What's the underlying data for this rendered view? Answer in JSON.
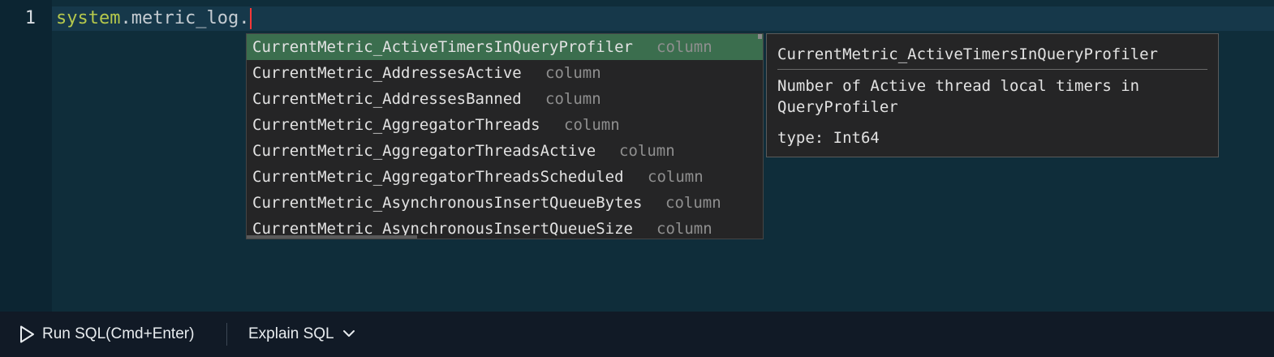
{
  "editor": {
    "line_number": "1",
    "code": {
      "schema": "system",
      "dot1": ".",
      "table": "metric_log",
      "dot2": "."
    }
  },
  "suggestions": {
    "selected_index": 0,
    "items": [
      {
        "label": "CurrentMetric_ActiveTimersInQueryProfiler",
        "kind": "column"
      },
      {
        "label": "CurrentMetric_AddressesActive",
        "kind": "column"
      },
      {
        "label": "CurrentMetric_AddressesBanned",
        "kind": "column"
      },
      {
        "label": "CurrentMetric_AggregatorThreads",
        "kind": "column"
      },
      {
        "label": "CurrentMetric_AggregatorThreadsActive",
        "kind": "column"
      },
      {
        "label": "CurrentMetric_AggregatorThreadsScheduled",
        "kind": "column"
      },
      {
        "label": "CurrentMetric_AsynchronousInsertQueueBytes",
        "kind": "column"
      },
      {
        "label": "CurrentMetric_AsynchronousInsertQueueSize",
        "kind": "column"
      }
    ]
  },
  "details": {
    "title": "CurrentMetric_ActiveTimersInQueryProfiler",
    "description": "Number of Active thread local timers in QueryProfiler",
    "type": "type: Int64"
  },
  "toolbar": {
    "run_label": "Run SQL(Cmd+Enter)",
    "run_icon": "play-icon",
    "explain_label": "Explain SQL",
    "explain_icon": "chevron-down-icon"
  },
  "colors": {
    "editor_bg": "#0f2d3a",
    "schema_token": "#b5c84c",
    "cursor": "#ff3838",
    "selected_suggestion": "#3b6e4e",
    "toolbar_bg": "#111a26"
  }
}
